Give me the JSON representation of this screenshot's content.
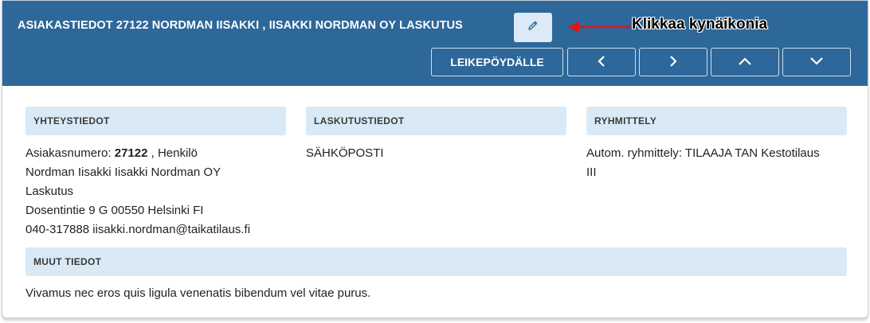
{
  "header": {
    "title": "ASIAKASTIEDOT 27122 NORDMAN IISAKKI , IISAKKI NORDMAN OY LASKUTUS",
    "edit_icon": "pencil-icon",
    "callout": "Klikkaa kynäikonia",
    "clipboard_label": "LEIKEPÖYDÄLLE",
    "nav_icons": [
      "chevron-left-icon",
      "chevron-right-icon",
      "chevron-up-icon",
      "chevron-down-icon"
    ]
  },
  "contact": {
    "heading": "YHTEYSTIEDOT",
    "customer_number_label": "Asiakasnumero:",
    "customer_number": "27122",
    "customer_type": ", Henkilö",
    "name_line1": "Nordman Iisakki Iisakki Nordman OY",
    "name_line2": "Laskutus",
    "address": "Dosentintie 9 G 00550 Helsinki FI",
    "phone_email": "040-317888 iisakki.nordman@taikatilaus.fi"
  },
  "billing": {
    "heading": "LASKUTUSTIEDOT",
    "method": "SÄHKÖPOSTI"
  },
  "grouping": {
    "heading": "RYHMITTELY",
    "line1": "Autom. ryhmittely: TILAAJA TAN Kestotilaus",
    "line2": "III"
  },
  "other": {
    "heading": "MUUT TIEDOT",
    "text": "Vivamus nec eros quis ligula venenatis bibendum vel vitae purus."
  },
  "colors": {
    "header_bg": "#2e6799",
    "section_bg": "#d9eaf6",
    "arrow": "#e0141b"
  }
}
